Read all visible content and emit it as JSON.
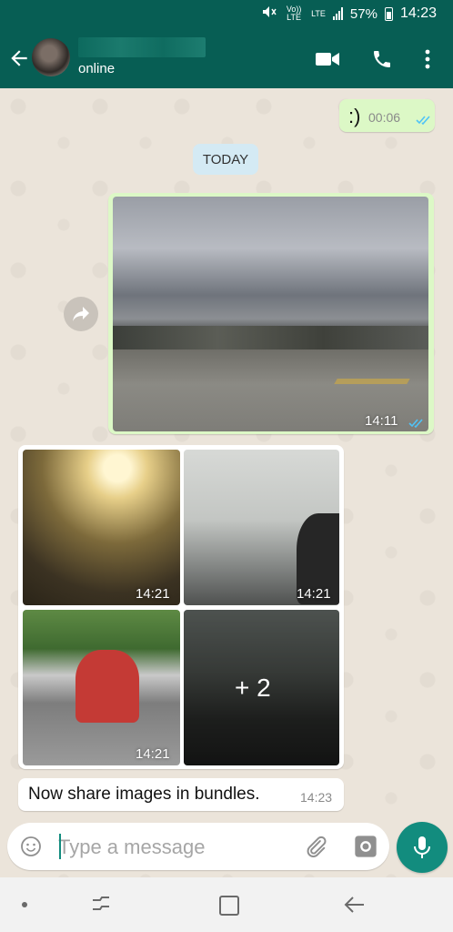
{
  "status_bar": {
    "volte": "Vo)) LTE",
    "lte": "LTE",
    "battery": "57%",
    "time": "14:23"
  },
  "header": {
    "contact_status": "online",
    "icons": [
      "back-arrow-icon",
      "video-call-icon",
      "phone-icon",
      "more-options-icon"
    ]
  },
  "messages": {
    "emoji_message": {
      "text": ":)",
      "time": "00:06"
    },
    "date_divider": "TODAY",
    "photo_message": {
      "time": "14:11"
    },
    "album": {
      "tiles": [
        {
          "time": "14:21"
        },
        {
          "time": "14:21"
        },
        {
          "time": "14:21"
        },
        {
          "more": "+ 2"
        }
      ],
      "caption": "Now share images in bundles.",
      "caption_time": "14:23"
    }
  },
  "composer": {
    "placeholder": "Type a message"
  },
  "colors": {
    "header": "#075e54",
    "accent": "#128c7e",
    "outgoing_bubble": "#dcf8c6",
    "read_ticks": "#4fc3f7"
  }
}
